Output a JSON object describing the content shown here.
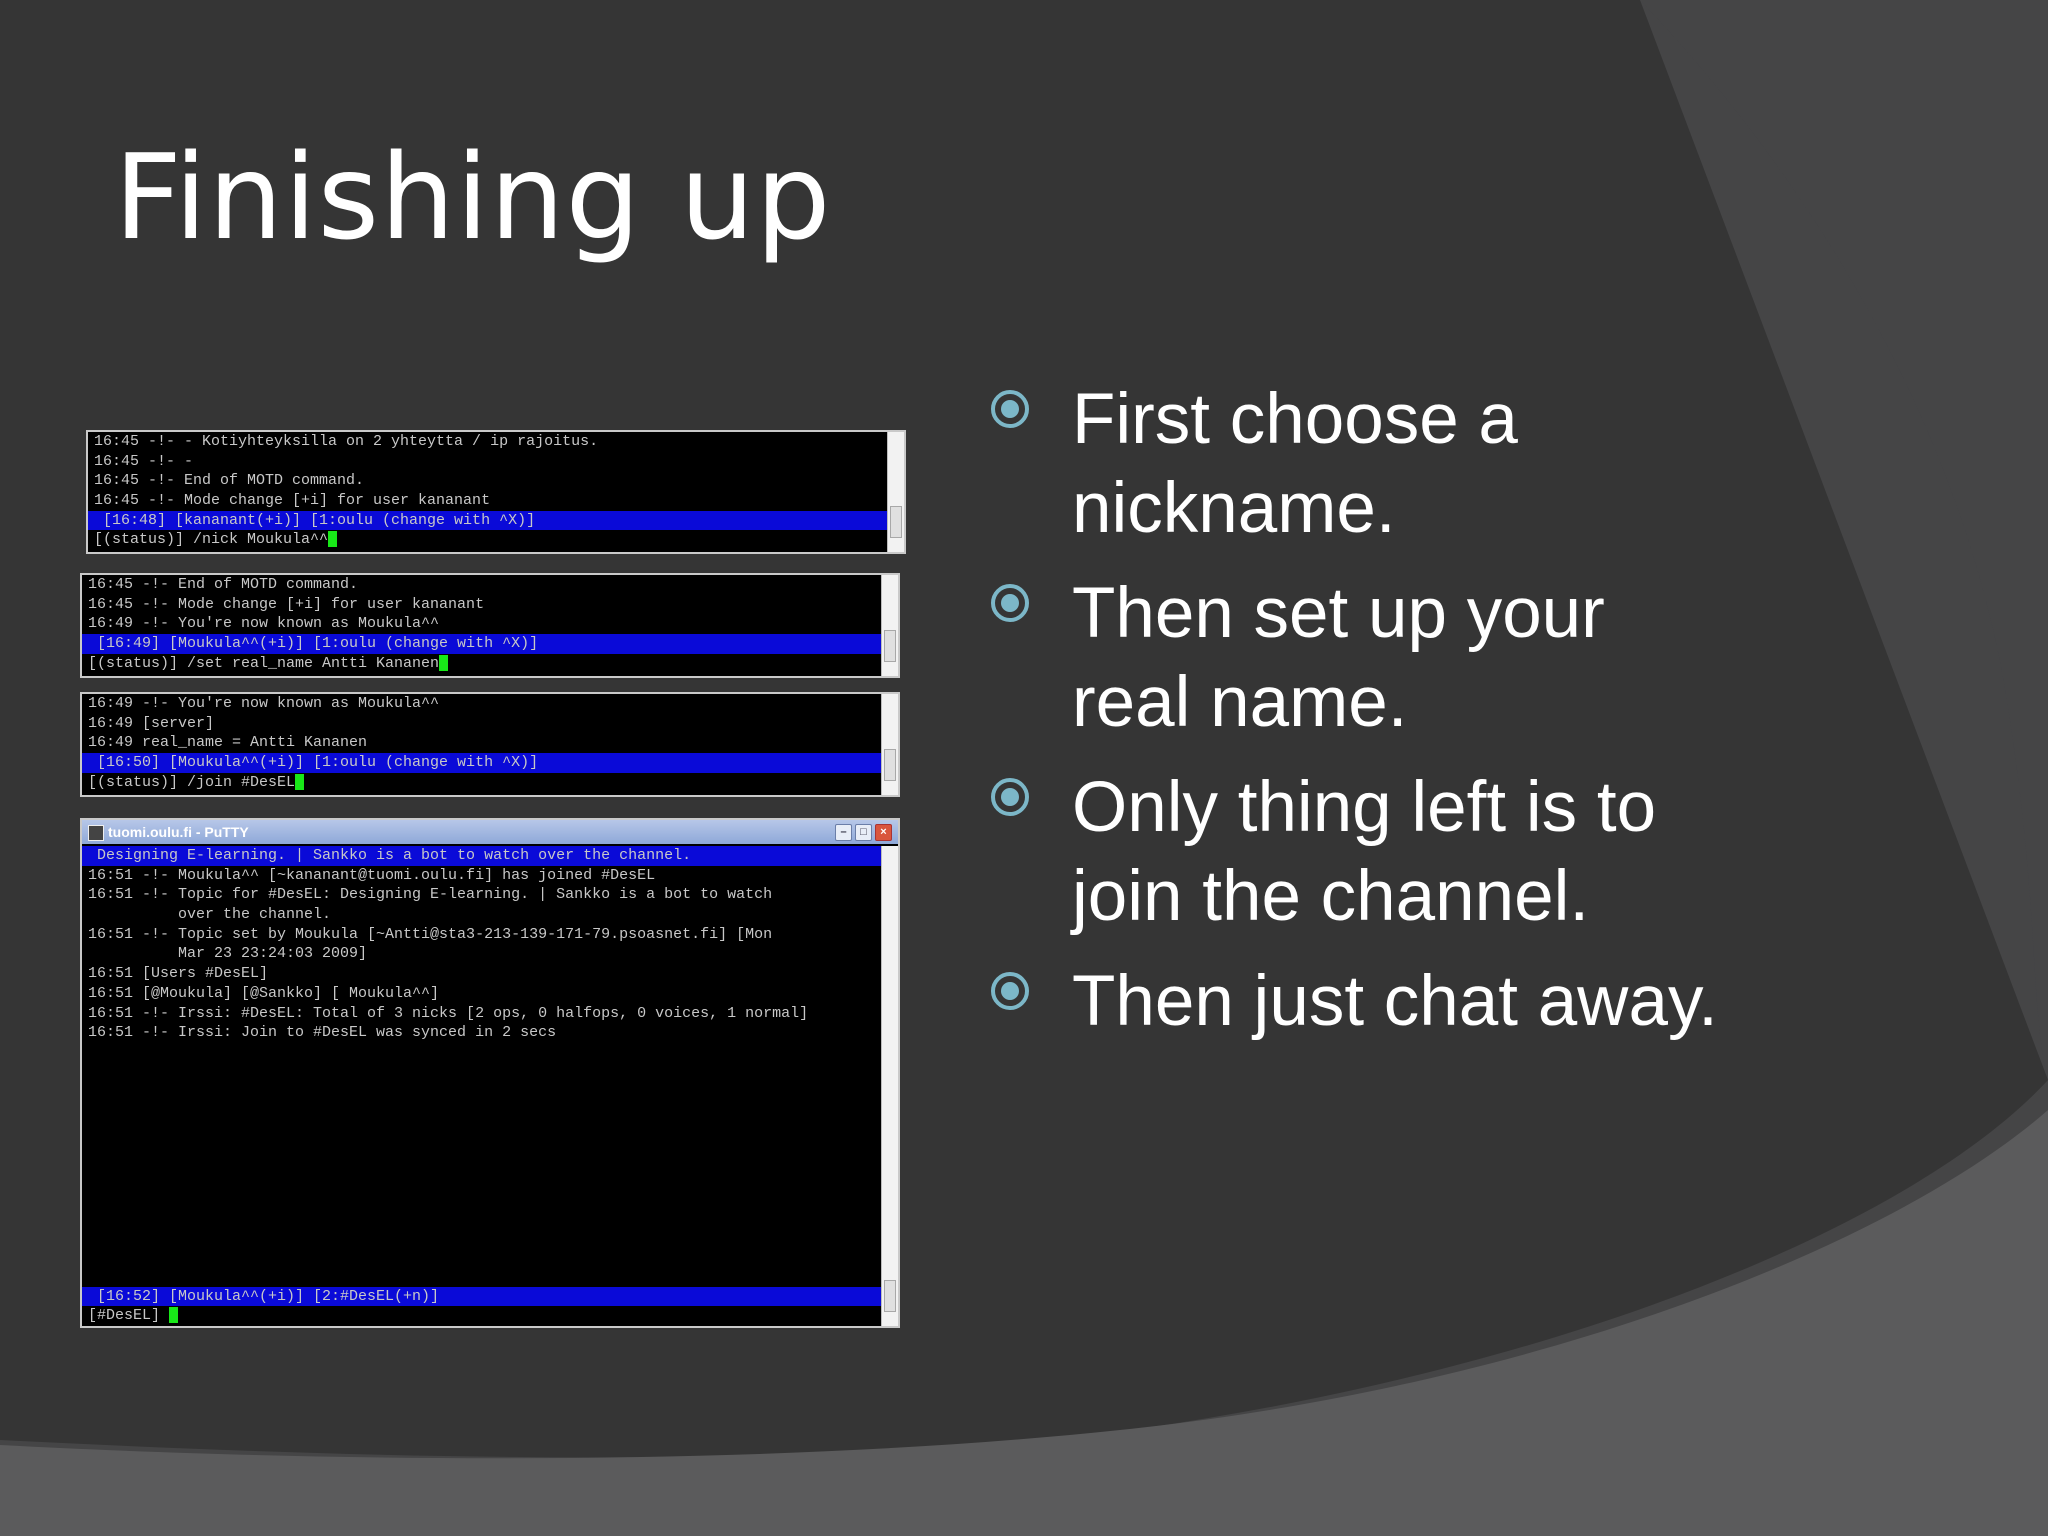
{
  "slide": {
    "title": "Finishing up",
    "colors": {
      "background": "#353535",
      "accent_shape": "#454546",
      "bottom_band": "#5b5b5c",
      "bullet": "#7cb7c8"
    },
    "bullet_icon": "circle-target-icon",
    "bullets": [
      {
        "lines": [
          "First choose a",
          "nickname."
        ]
      },
      {
        "lines": [
          "Then set up your",
          "real name."
        ]
      },
      {
        "lines": [
          "Only thing left is to",
          "join the channel."
        ]
      },
      {
        "lines": [
          "Then just chat away."
        ]
      }
    ]
  },
  "terminal1": {
    "lines": [
      "16:45 -!- - Kotiyhteyksilla on 2 yhteytta / ip rajoitus.",
      "16:45 -!- -",
      "16:45 -!- End of MOTD command.",
      "16:45 -!- Mode change [+i] for user kananant"
    ],
    "status_line": " [16:48] [kananant(+i)] [1:oulu (change with ^X)]",
    "input_line": "[(status)] /nick Moukula^^"
  },
  "terminal2": {
    "lines": [
      "16:45 -!- End of MOTD command.",
      "16:45 -!- Mode change [+i] for user kananant",
      "16:49 -!- You're now known as Moukula^^"
    ],
    "status_line": " [16:49] [Moukula^^(+i)] [1:oulu (change with ^X)]",
    "input_line": "[(status)] /set real_name Antti Kananen"
  },
  "terminal3": {
    "lines": [
      "16:49 -!- You're now known as Moukula^^",
      "16:49 [server]",
      "16:49 real_name = Antti Kananen"
    ],
    "status_line": " [16:50] [Moukula^^(+i)] [1:oulu (change with ^X)]",
    "input_line": "[(status)] /join #DesEL"
  },
  "terminal4": {
    "window_title": "tuomi.oulu.fi - PuTTY",
    "topic_line": " Designing E-learning. | Sankko is a bot to watch over the channel.",
    "lines": [
      "16:51 -!- Moukula^^ [~kananant@tuomi.oulu.fi] has joined #DesEL",
      "16:51 -!- Topic for #DesEL: Designing E-learning. | Sankko is a bot to watch",
      "          over the channel.",
      "16:51 -!- Topic set by Moukula [~Antti@sta3-213-139-171-79.psoasnet.fi] [Mon",
      "          Mar 23 23:24:03 2009]",
      "16:51 [Users #DesEL]",
      "16:51 [@Moukula] [@Sankko] [ Moukula^^]",
      "16:51 -!- Irssi: #DesEL: Total of 3 nicks [2 ops, 0 halfops, 0 voices, 1 normal]",
      "16:51 -!- Irssi: Join to #DesEL was synced in 2 secs"
    ],
    "status_line": " [16:52] [Moukula^^(+i)] [2:#DesEL(+n)]",
    "input_line": "[#DesEL] "
  }
}
